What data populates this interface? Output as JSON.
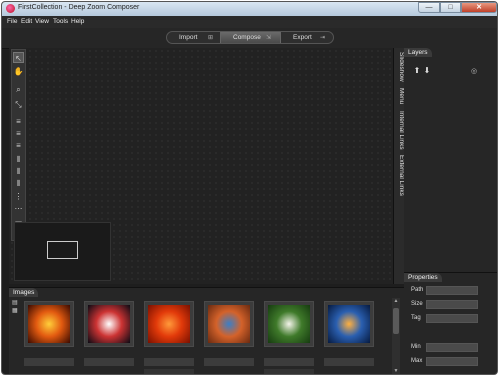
{
  "window": {
    "title": "FirstCollection - Deep Zoom Composer",
    "controls": {
      "minimize": "—",
      "maximize": "□",
      "close": "✕"
    }
  },
  "menu": [
    "File",
    "Edit",
    "View",
    "Tools",
    "Help"
  ],
  "tabs": [
    {
      "label": "Import",
      "icon": "⊞",
      "active": false
    },
    {
      "label": "Compose",
      "icon": "⇲",
      "active": true
    },
    {
      "label": "Export",
      "icon": "⇥",
      "active": false
    }
  ],
  "toolbox": {
    "tools": [
      {
        "name": "select-tool",
        "glyph": "↖",
        "active": true
      },
      {
        "name": "pan-tool",
        "glyph": "✋",
        "active": false
      },
      {
        "name": "zoom-tool",
        "glyph": "⌕",
        "active": false
      },
      {
        "name": "fit-tool",
        "glyph": "⤡",
        "active": false
      },
      {
        "name": "align-left-tool",
        "glyph": "≡",
        "active": false
      },
      {
        "name": "align-center-tool",
        "glyph": "≡",
        "active": false
      },
      {
        "name": "align-right-tool",
        "glyph": "≡",
        "active": false
      },
      {
        "name": "align-top-tool",
        "glyph": "⫴",
        "active": false
      },
      {
        "name": "align-middle-tool",
        "glyph": "⫴",
        "active": false
      },
      {
        "name": "align-bottom-tool",
        "glyph": "⫴",
        "active": false
      },
      {
        "name": "distribute-horizontal-tool",
        "glyph": "⋮",
        "active": false
      },
      {
        "name": "distribute-vertical-tool",
        "glyph": "⋯",
        "active": false
      },
      {
        "name": "size-width-tool",
        "glyph": "▭",
        "active": false
      },
      {
        "name": "size-height-tool",
        "glyph": "▯",
        "active": false
      }
    ]
  },
  "side_tabs": [
    "Slideshow",
    "Menu",
    "Internal Links",
    "External Links"
  ],
  "layers": {
    "header": "Layers",
    "up_icon": "⬆",
    "down_icon": "⬇",
    "visibility_icon": "◎"
  },
  "properties": {
    "header": "Properties",
    "fields": [
      {
        "label": "Path",
        "value": ""
      },
      {
        "label": "Size",
        "value": ""
      },
      {
        "label": "Tag",
        "value": ""
      },
      {
        "label": "Min",
        "value": ""
      },
      {
        "label": "Max",
        "value": ""
      }
    ]
  },
  "images": {
    "header": "Images",
    "view_icons": [
      "▤",
      "▦"
    ],
    "thumbnails": [
      {
        "name": "sun",
        "colors": [
          "#ffcf3a",
          "#e25a10",
          "#3a0a00"
        ]
      },
      {
        "name": "astronaut",
        "colors": [
          "#ffffff",
          "#c33",
          "#0a0a14"
        ]
      },
      {
        "name": "red-flower",
        "colors": [
          "#ff9a3a",
          "#e23a0a",
          "#7a1000"
        ]
      },
      {
        "name": "desert-mesa",
        "colors": [
          "#3b7fc7",
          "#d4622a",
          "#6a2a10"
        ]
      },
      {
        "name": "white-flower",
        "colors": [
          "#f4f4ea",
          "#3f7a2a",
          "#163b10"
        ]
      },
      {
        "name": "jellyfish",
        "colors": [
          "#ffb040",
          "#2a5fb0",
          "#061a40"
        ]
      }
    ]
  },
  "scrollbar": {
    "up": "▲",
    "down": "▼"
  }
}
